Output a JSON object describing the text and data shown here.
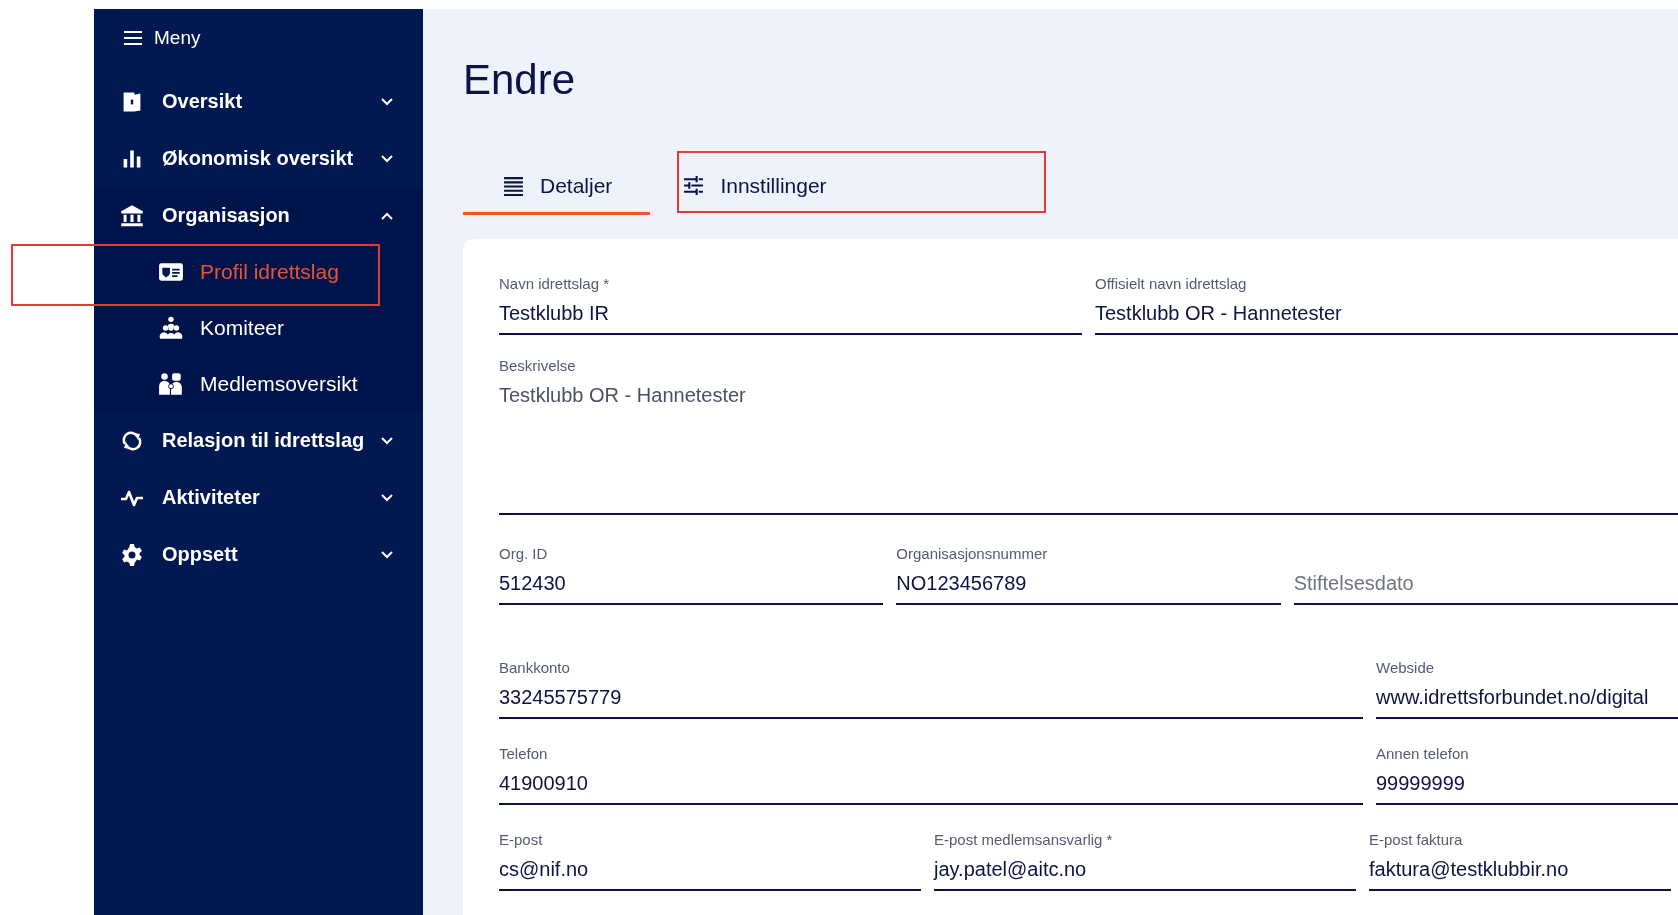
{
  "sidebar": {
    "menu_label": "Meny",
    "items": [
      {
        "label": "Oversikt",
        "expanded": false
      },
      {
        "label": "Økonomisk oversikt",
        "expanded": false
      },
      {
        "label": "Organisasjon",
        "expanded": true,
        "children": [
          {
            "label": "Profil idrettslag",
            "selected": true,
            "highlighted": true
          },
          {
            "label": "Komiteer",
            "selected": false,
            "highlighted": false
          },
          {
            "label": "Medlemsoversikt",
            "selected": false,
            "highlighted": false
          }
        ]
      },
      {
        "label": "Relasjon til idrettslag",
        "expanded": false
      },
      {
        "label": "Aktiviteter",
        "expanded": false
      },
      {
        "label": "Oppsett",
        "expanded": false
      }
    ]
  },
  "page": {
    "title": "Endre"
  },
  "tabs": [
    {
      "label": "Detaljer",
      "selected": true,
      "highlighted": false
    },
    {
      "label": "Innstillinger",
      "selected": false,
      "highlighted": true
    }
  ],
  "form": {
    "rows": [
      [
        {
          "label": "Navn idrettslag *",
          "value": "Testklubb IR"
        },
        {
          "label": "Offisielt navn idrettslag",
          "value": "Testklubb OR - Hannetester"
        }
      ],
      [
        {
          "label": "Beskrivelse",
          "value": "Testklubb OR - Hannetester",
          "kind": "textarea"
        }
      ],
      [
        {
          "label": "Org. ID",
          "value": "512430"
        },
        {
          "label": "Organisasjonsnummer",
          "value": "NO123456789"
        },
        {
          "placeholder": "Stiftelsesdato"
        }
      ],
      [
        {
          "label": "Bankkonto",
          "value": "33245575779"
        },
        {
          "label": "Webside",
          "value": "www.idrettsforbundet.no/digital"
        }
      ],
      [
        {
          "label": "Telefon",
          "value": "41900910"
        },
        {
          "label": "Annen telefon",
          "value": "99999999"
        }
      ],
      [
        {
          "label": "E-post",
          "value": "cs@nif.no"
        },
        {
          "label": "E-post medlemsansvarlig *",
          "value": "jay.patel@aitc.no"
        },
        {
          "label": "E-post faktura",
          "value": "faktura@testklubbir.no"
        }
      ]
    ]
  }
}
